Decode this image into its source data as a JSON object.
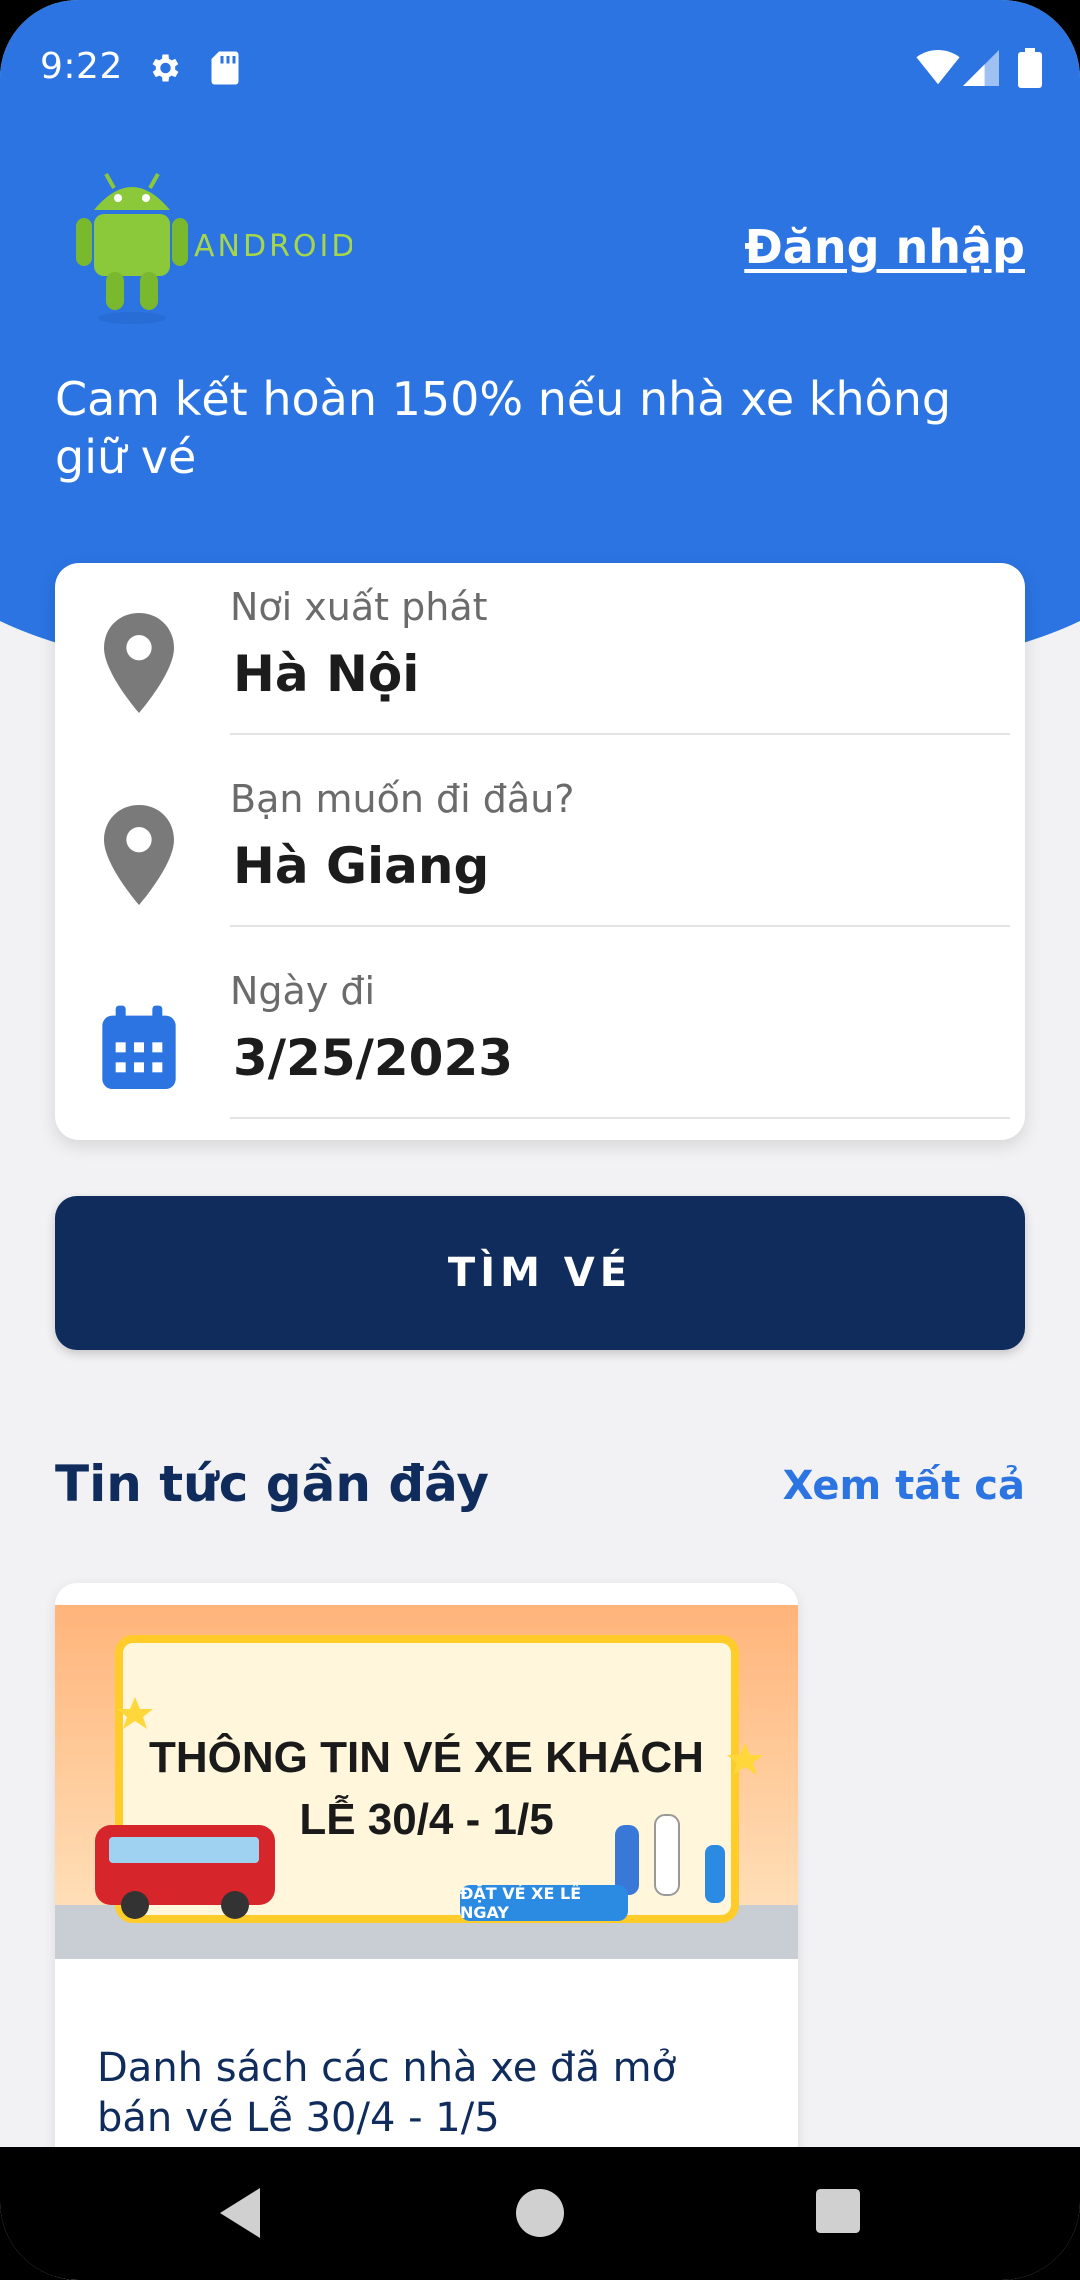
{
  "status_bar": {
    "time": "9:22"
  },
  "header": {
    "logo_alt": "ANDROID",
    "login_label": "Đăng nhập",
    "tagline": "Cam kết hoàn 150% nếu nhà xe không giữ vé"
  },
  "search": {
    "origin": {
      "label": "Nơi xuất phát",
      "value": "Hà Nội"
    },
    "destination": {
      "label": "Bạn muốn đi đâu?",
      "value": "Hà Giang"
    },
    "date": {
      "label": "Ngày đi",
      "value": "3/25/2023"
    },
    "button_label": "TÌM VÉ"
  },
  "news": {
    "section_title": "Tin tức gần đây",
    "see_all_label": "Xem tất cả",
    "items": [
      {
        "banner_line1": "THÔNG TIN VÉ XE KHÁCH",
        "banner_line2": "LỄ 30/4 - 1/5",
        "banner_cta": "ĐẶT VÉ XE LỄ NGAY",
        "headline": "Danh sách các nhà xe đã mở bán vé Lễ 30/4 - 1/5"
      }
    ]
  },
  "colors": {
    "primary": "#2b74e2",
    "navy": "#0f2c5c",
    "background": "#f2f2f4"
  },
  "icons": [
    "gear-icon",
    "sd-card-icon",
    "wifi-icon",
    "signal-icon",
    "battery-icon",
    "location-pin-icon",
    "calendar-icon",
    "back-icon",
    "home-icon",
    "recents-icon"
  ]
}
